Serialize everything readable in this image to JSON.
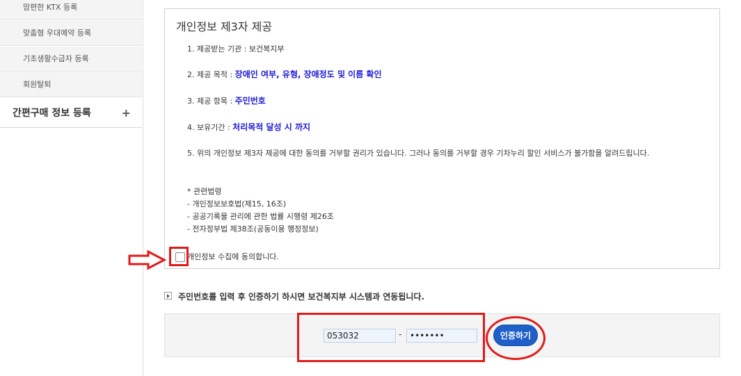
{
  "sidebar": {
    "sub_items": [
      {
        "label": "맘편한 KTX 등록"
      },
      {
        "label": "맞춤형 우대예약 등록"
      },
      {
        "label": "기초생활수급자 등록"
      },
      {
        "label": "회원탈퇴"
      }
    ],
    "main_item": {
      "label": "간편구매 정보 등록",
      "expand": "+"
    }
  },
  "consent": {
    "title": "개인정보 제3자 제공",
    "item1": {
      "label": "1. 제공받는 기관 : 보건복지부"
    },
    "item2": {
      "label": "2. 제공 목적 : ",
      "value": "장애인 여부, 유형, 장애정도 및 이름 확인"
    },
    "item3": {
      "label": "3. 제공 항목 : ",
      "value": "주민번호"
    },
    "item4": {
      "label": "4. 보유기간 : ",
      "value": "처리목적 달성 시 까지"
    },
    "item5": "5. 위의 개인정보 제3자 제공에 대한 동의를 거부할 권리가 있습니다. 그러나 동의를 거부할 경우 기차누리 할인 서비스가 불가함을 알려드립니다.",
    "law_title": "* 관련법령",
    "laws": [
      "- 개인정보보호법(제15, 16조)",
      "- 공공기록물 관리에 관한 법률 시행령 제26조",
      "- 전자정부법 제38조(공동이용 행정정보)"
    ],
    "agree_label": "개인정보 수집에 동의합니다.",
    "agree_checked": false
  },
  "info": {
    "text": "주민번호를 입력 후 인증하기 하시면 보건복지부 시스템과 연동됩니다."
  },
  "auth": {
    "ssn_front": "053032",
    "ssn_back": "•••••••",
    "separator": "-",
    "button_label": "인증하기"
  },
  "colors": {
    "highlight": "#1d1ad6",
    "annotation_red": "#e01a1a",
    "button_blue": "#1f5fc8"
  }
}
